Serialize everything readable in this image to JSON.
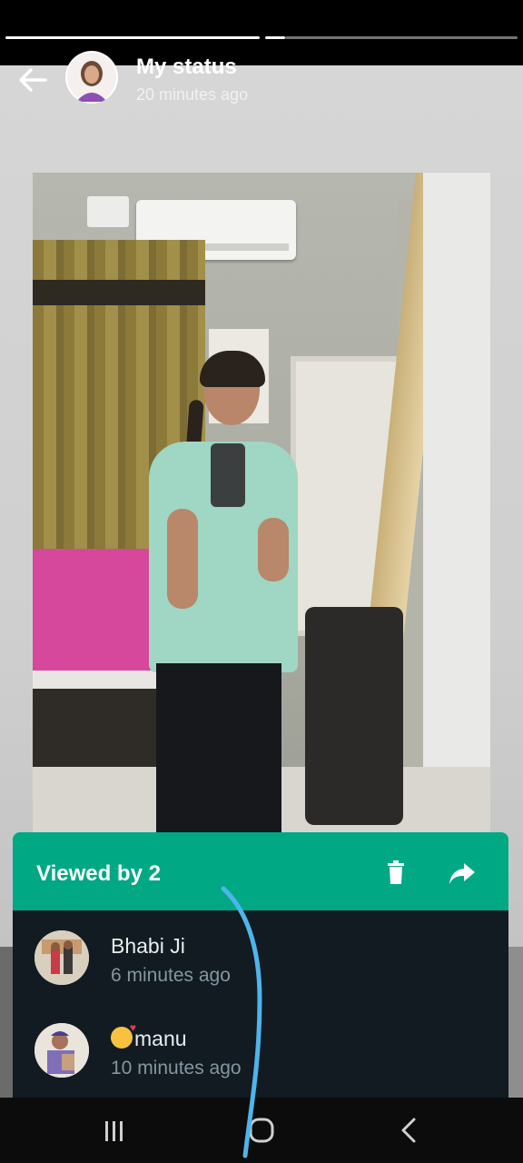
{
  "status": {
    "title": "My status",
    "timestamp": "20 minutes ago",
    "progress_segments": [
      {
        "state": "viewed"
      },
      {
        "state": "current"
      }
    ]
  },
  "header_icons": {
    "back": "back-arrow-icon",
    "avatar": "profile-avatar"
  },
  "viewers": {
    "title": "Viewed by 2",
    "accent_color": "#00a884",
    "list_bg_color": "#111b21",
    "actions": [
      "delete-icon",
      "forward-icon"
    ],
    "items": [
      {
        "name": "Bhabi Ji",
        "time": "6 minutes ago",
        "emoji": ""
      },
      {
        "name": "manu",
        "time": "10 minutes ago",
        "emoji": "smiling-face-with-hearts"
      }
    ]
  },
  "navbar": {
    "buttons": [
      "recent-apps-icon",
      "home-icon",
      "back-icon"
    ]
  }
}
